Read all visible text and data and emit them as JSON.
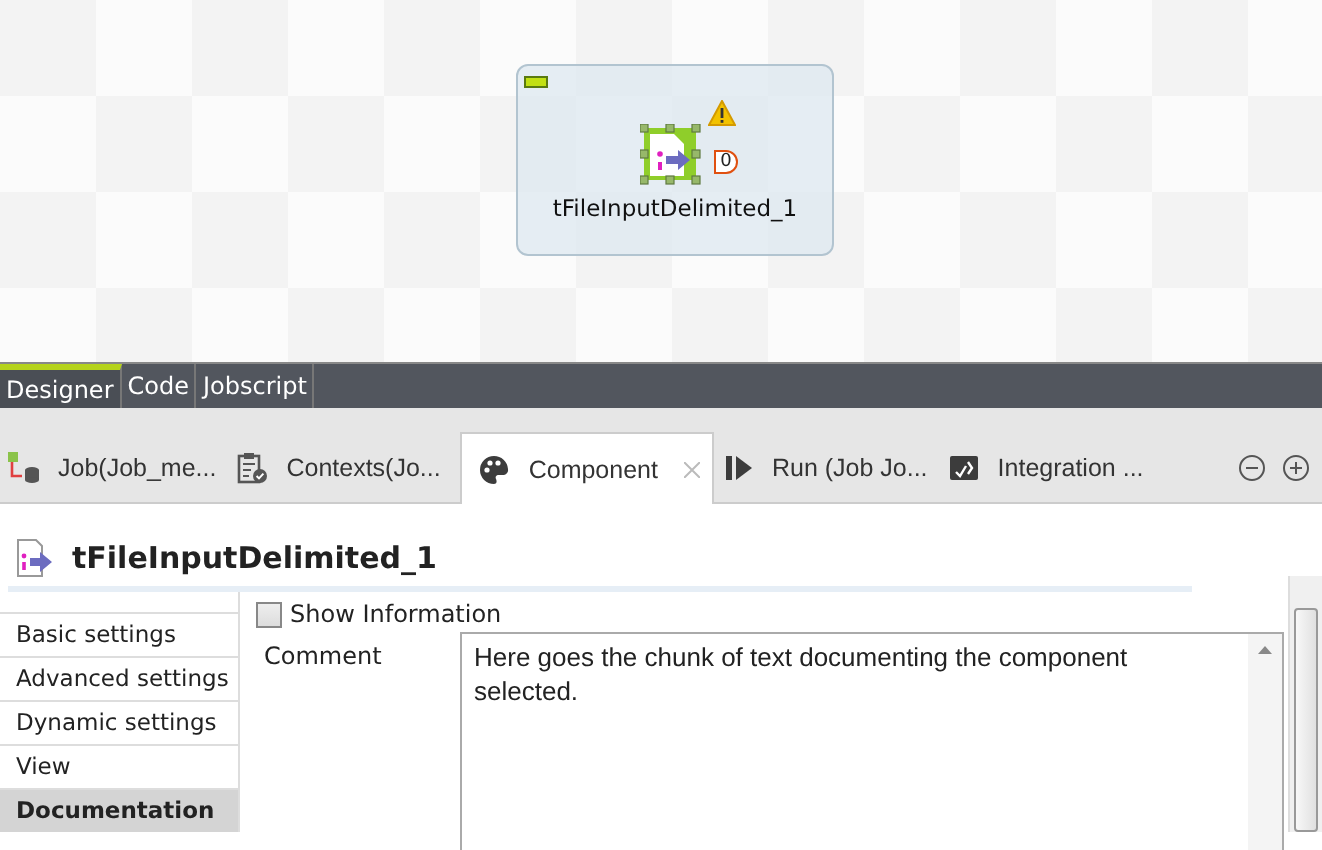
{
  "designer": {
    "component": {
      "label": "tFileInputDelimited_1",
      "warning": true,
      "selected": true,
      "output_label": "0"
    }
  },
  "editor_tabs": [
    {
      "label": "Designer",
      "selected": true
    },
    {
      "label": "Code",
      "selected": false
    },
    {
      "label": "Jobscript",
      "selected": false
    }
  ],
  "view_tabs": [
    {
      "kind": "job",
      "label": "Job(Job_me...",
      "selected": false
    },
    {
      "kind": "contexts",
      "label": "Contexts(Jo...",
      "selected": false
    },
    {
      "kind": "component",
      "label": "Component",
      "selected": true
    },
    {
      "kind": "run",
      "label": "Run (Job Jo...",
      "selected": false
    },
    {
      "kind": "integration",
      "label": "Integration ...",
      "selected": false
    }
  ],
  "component_title": "tFileInputDelimited_1",
  "settings_nav": [
    {
      "label": "Basic settings",
      "selected": false
    },
    {
      "label": "Advanced settings",
      "selected": false
    },
    {
      "label": "Dynamic settings",
      "selected": false
    },
    {
      "label": "View",
      "selected": false
    },
    {
      "label": "Documentation",
      "selected": true
    }
  ],
  "show_information": {
    "label": "Show Information",
    "checked": false
  },
  "comment": {
    "label": "Comment",
    "value": "Here goes the chunk of text documenting the component selected."
  }
}
